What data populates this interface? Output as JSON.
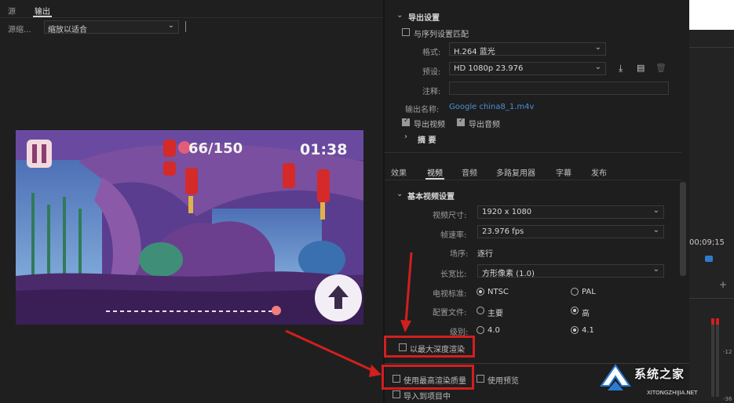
{
  "left_panel": {
    "tabs": [
      {
        "label": "源"
      },
      {
        "label": "输出"
      }
    ],
    "source_label": "源缩...",
    "scale_value": "缩放以适合"
  },
  "preview": {
    "score": "66/150",
    "timer": "01:38"
  },
  "export_settings": {
    "title": "导出设置",
    "match_sequence_label": "与序列设置匹配",
    "format_label": "格式:",
    "format_value": "H.264 蓝光",
    "preset_label": "预设:",
    "preset_value": "HD 1080p 23.976",
    "comment_label": "注释:",
    "comment_value": "",
    "output_name_label": "输出名称:",
    "output_name_value": "Google china8_1.m4v",
    "export_video_label": "导出视频",
    "export_audio_label": "导出音频",
    "export_video_checked": true,
    "export_audio_checked": true,
    "summary_label": "摘 要"
  },
  "tabs": [
    {
      "label": "效果"
    },
    {
      "label": "视频"
    },
    {
      "label": "音频"
    },
    {
      "label": "多路复用器"
    },
    {
      "label": "字幕"
    },
    {
      "label": "发布"
    }
  ],
  "video_settings": {
    "title": "基本视频设置",
    "frame_size_label": "视频尺寸:",
    "frame_size_value": "1920 x 1080",
    "frame_rate_label": "帧速率:",
    "frame_rate_value": "23.976 fps",
    "field_order_label": "场序:",
    "field_order_value": "逐行",
    "aspect_label": "长宽比:",
    "aspect_value": "方形像素 (1.0)",
    "tv_standard_label": "电视标准:",
    "tv_ntsc": "NTSC",
    "tv_pal": "PAL",
    "profile_label": "配置文件:",
    "profile_main": "主要",
    "profile_high": "高",
    "level_label": "级别:",
    "level_40": "4.0",
    "level_41": "4.1"
  },
  "render_options": {
    "max_depth_label": "以最大深度渲染",
    "max_quality_label": "使用最高渲染质量",
    "use_previews_label": "使用预览",
    "import_project_label": "导入到项目中"
  },
  "side_strip": {
    "timecode": "00;09;15",
    "meter_top": "-12",
    "meter_bottom": "-36"
  },
  "watermark": {
    "text": "系统之家",
    "url": "XITONGZHIJIA.NET"
  },
  "colors": {
    "annotation_red": "#d21f1f",
    "link_blue": "#4b8fd6",
    "accent_blue": "#2d7bd0"
  }
}
